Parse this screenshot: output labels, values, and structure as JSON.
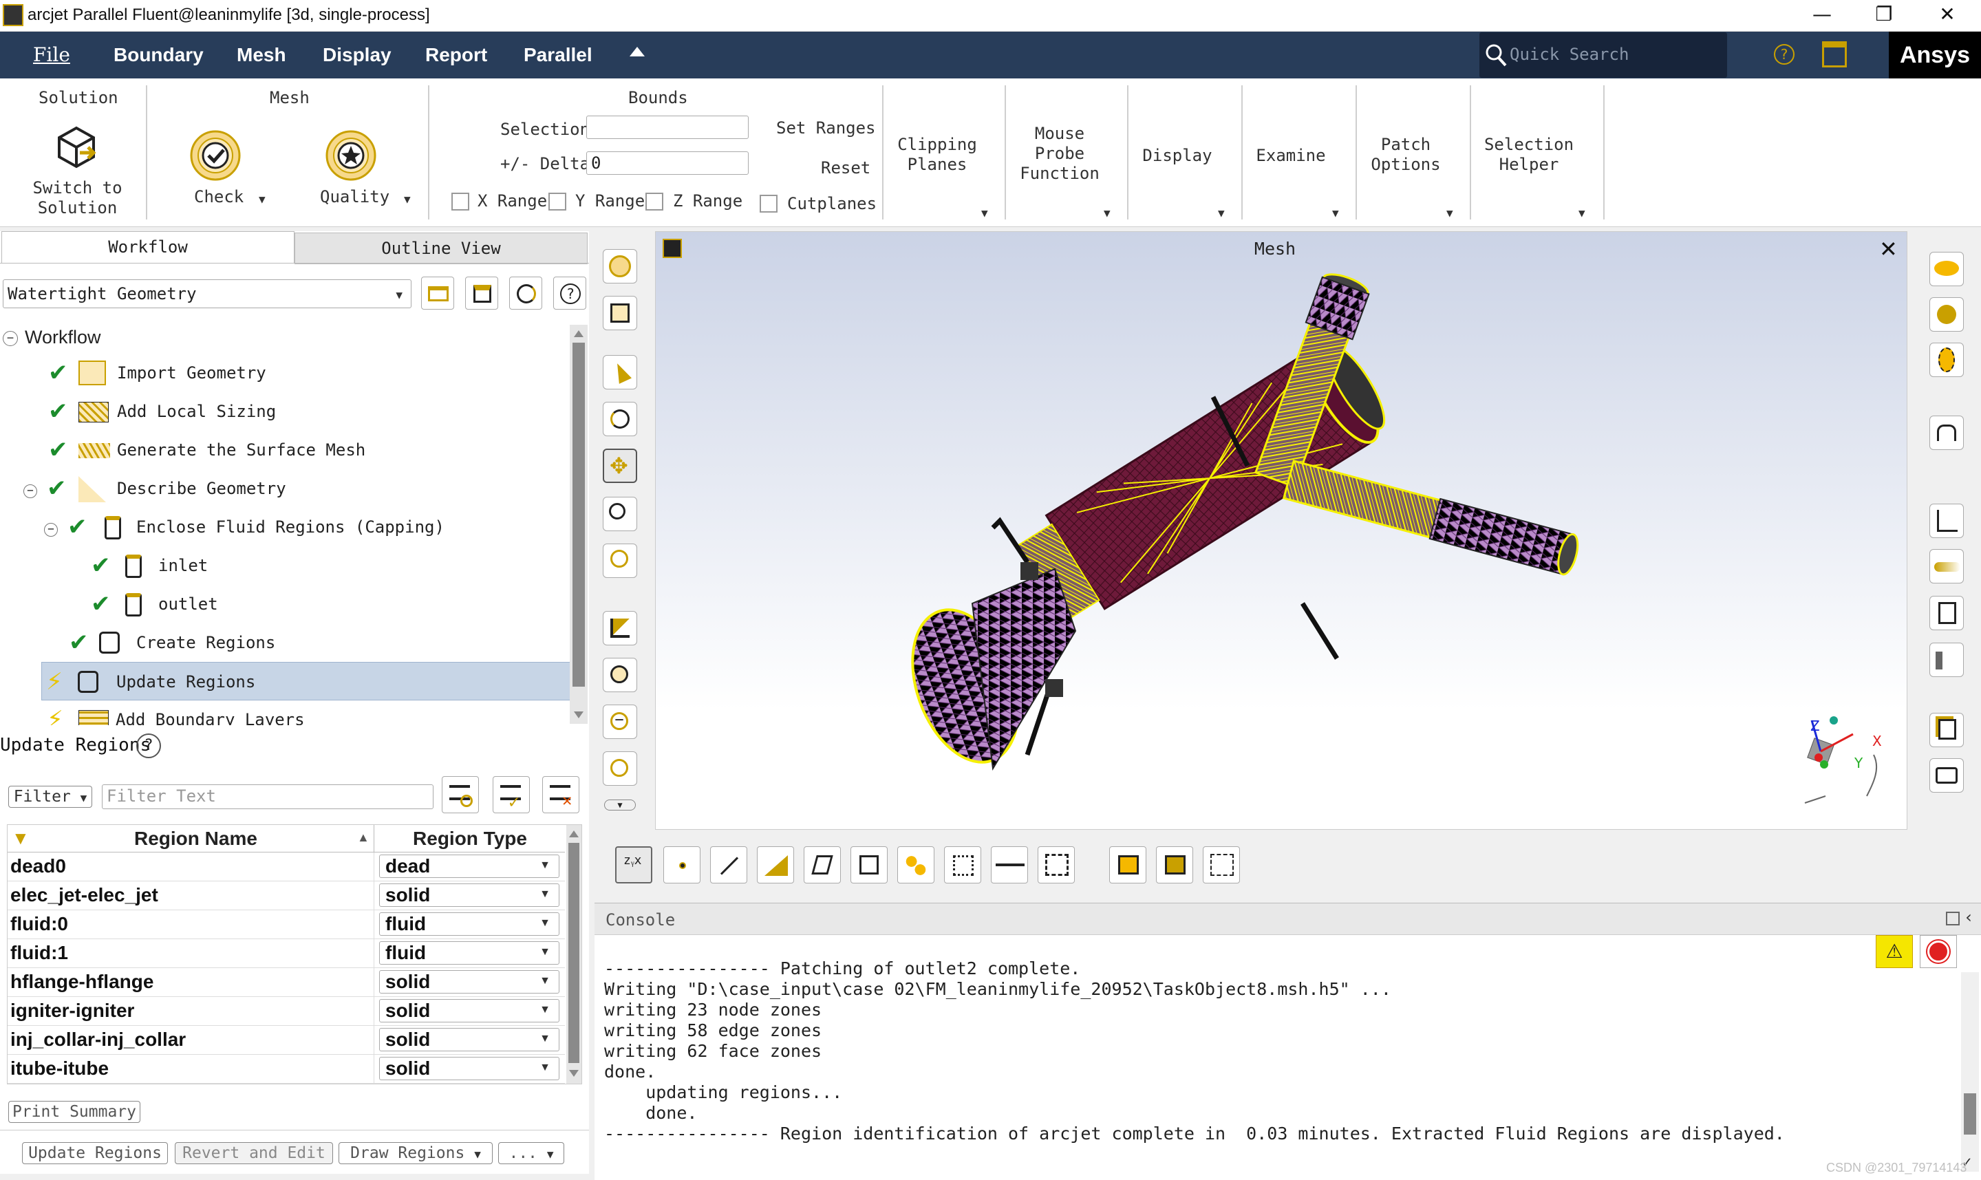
{
  "window": {
    "title": "arcjet Parallel Fluent@leaninmylife  [3d, single-process]"
  },
  "menu": {
    "file": "File",
    "items": [
      "Boundary",
      "Mesh",
      "Display",
      "Report",
      "Parallel"
    ]
  },
  "search": {
    "placeholder": "Quick Search"
  },
  "brand": {
    "logo": "Ansys",
    "accent": "#283d5a"
  },
  "ribbon": {
    "solution": {
      "title": "Solution",
      "switch": "Switch to\nSolution"
    },
    "mesh": {
      "title": "Mesh",
      "check": "Check",
      "quality": "Quality"
    },
    "bounds": {
      "title": "Bounds",
      "selection": "Selection",
      "delta": "+/- Delta",
      "delta_value": "0",
      "set_ranges": "Set Ranges",
      "reset": "Reset",
      "x_range": "X Range",
      "y_range": "Y Range",
      "z_range": "Z Range",
      "cutplanes": "Cutplanes"
    },
    "clipping": "Clipping\nPlanes",
    "mouse_probe": "Mouse\nProbe\nFunction",
    "display": "Display",
    "examine": "Examine",
    "patch": "Patch\nOptions",
    "selection_helper": "Selection\nHelper"
  },
  "tabs": {
    "workflow": "Workflow",
    "outline": "Outline View"
  },
  "workflow_select": "Watertight Geometry",
  "tree": {
    "root": "Workflow",
    "items": [
      {
        "label": "Import Geometry",
        "status": "done"
      },
      {
        "label": "Add Local Sizing",
        "status": "done"
      },
      {
        "label": "Generate the Surface Mesh",
        "status": "done"
      },
      {
        "label": "Describe Geometry",
        "status": "done"
      },
      {
        "label": "Enclose Fluid Regions (Capping)",
        "status": "done"
      },
      {
        "label": "inlet",
        "status": "done"
      },
      {
        "label": "outlet",
        "status": "done"
      },
      {
        "label": "Create Regions",
        "status": "done"
      },
      {
        "label": "Update Regions",
        "status": "pending"
      },
      {
        "label": "Add Boundary Layers",
        "status": "pending"
      }
    ]
  },
  "task": {
    "title": "Update Regions",
    "filter_label": "Filter",
    "filter_placeholder": "Filter Text",
    "columns": [
      "Region Name",
      "Region Type"
    ],
    "rows": [
      {
        "name": "dead0",
        "type": "dead"
      },
      {
        "name": "elec_jet-elec_jet",
        "type": "solid"
      },
      {
        "name": "fluid:0",
        "type": "fluid"
      },
      {
        "name": "fluid:1",
        "type": "fluid"
      },
      {
        "name": "hflange-hflange",
        "type": "solid"
      },
      {
        "name": "igniter-igniter",
        "type": "solid"
      },
      {
        "name": "inj_collar-inj_collar",
        "type": "solid"
      },
      {
        "name": "itube-itube",
        "type": "solid"
      }
    ],
    "print_summary": "Print Summary",
    "buttons": [
      "Update Regions",
      "Revert and Edit",
      "Draw Regions",
      "..."
    ]
  },
  "graphics": {
    "title": "Mesh",
    "axes": {
      "x": "X",
      "y": "Y",
      "z": "Z"
    }
  },
  "console": {
    "title": "Console",
    "lines": [
      "---------------- Patching of outlet2 complete.",
      "Writing \"D:\\case_input\\case 02\\FM_leaninmylife_20952\\TaskObject8.msh.h5\" ...",
      "writing 23 node zones",
      "writing 58 edge zones",
      "writing 62 face zones",
      "done.",
      "    updating regions...",
      "    done.",
      "---------------- Region identification of arcjet complete in  0.03 minutes. Extracted Fluid Regions are displayed."
    ]
  },
  "watermark": "CSDN @2301_79714143"
}
